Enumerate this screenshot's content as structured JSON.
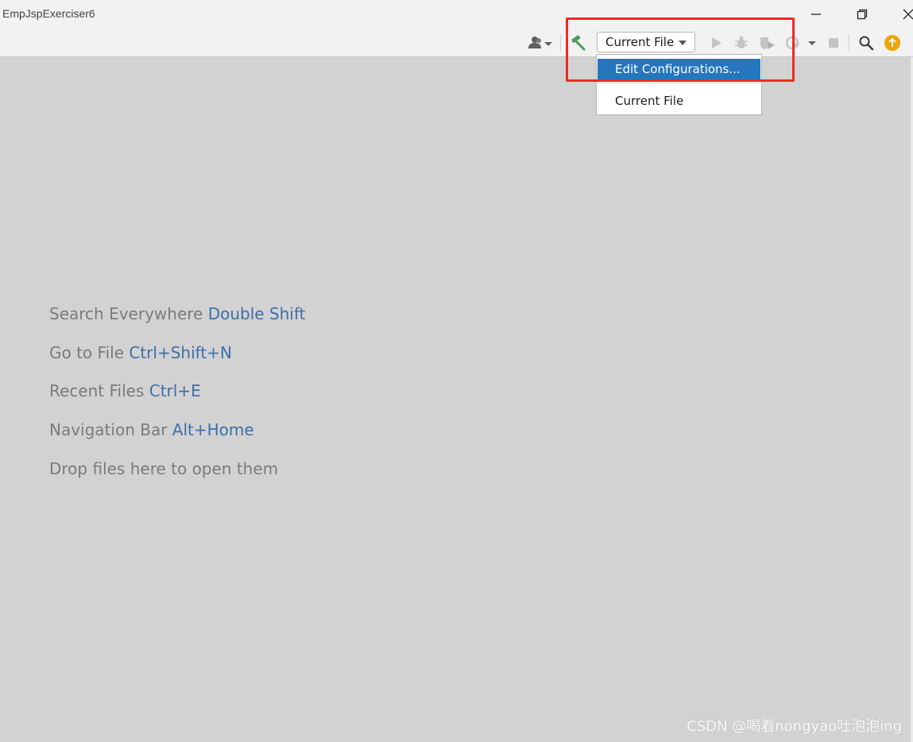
{
  "window": {
    "title": "EmpJspExerciser6"
  },
  "toolbar": {
    "run_config_label": "Current File",
    "icons": [
      "user-icon",
      "build-hammer-icon",
      "run-icon",
      "debug-icon",
      "coverage-icon",
      "profiler-icon",
      "stop-icon",
      "search-icon",
      "update-icon"
    ]
  },
  "dropdown": {
    "items": [
      {
        "label": "Edit Configurations...",
        "selected": true
      },
      {
        "label": "Current File",
        "selected": false
      }
    ]
  },
  "editor_hints": [
    {
      "text": "Search Everywhere",
      "shortcut": "Double Shift"
    },
    {
      "text": "Go to File",
      "shortcut": "Ctrl+Shift+N"
    },
    {
      "text": "Recent Files",
      "shortcut": "Ctrl+E"
    },
    {
      "text": "Navigation Bar",
      "shortcut": "Alt+Home"
    },
    {
      "text": "Drop files here to open them",
      "shortcut": ""
    }
  ],
  "watermark": "CSDN @喝着nongyao吐泡泡ing",
  "colors": {
    "accent_selected": "#2675bf",
    "shortcut_blue": "#3d6fa8",
    "annotation_red": "#ef2a22",
    "editor_bg": "#d2d2d2"
  }
}
